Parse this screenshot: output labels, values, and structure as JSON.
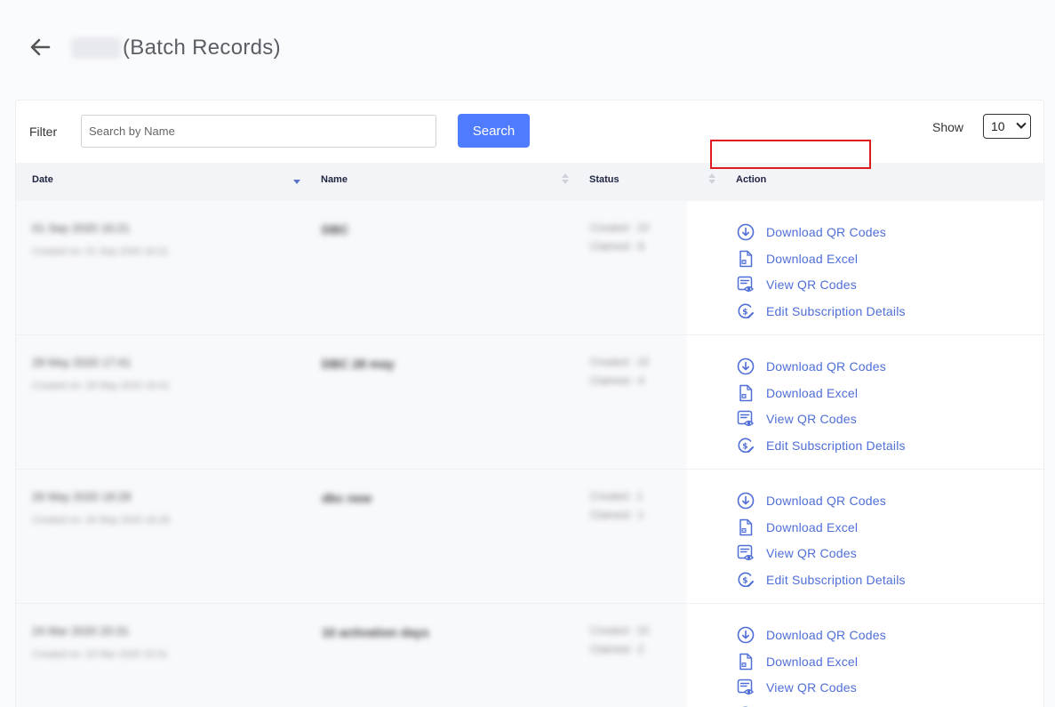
{
  "header": {
    "back_icon": "arrow-left-icon",
    "title_prefix_blurred": "DBC",
    "title_suffix": "(Batch Records)"
  },
  "filter": {
    "label": "Filter",
    "search_placeholder": "Search by Name",
    "search_value": "",
    "search_button": "Search",
    "show_label": "Show",
    "show_value": "10"
  },
  "table": {
    "columns": [
      {
        "label": "Date",
        "sort": "desc"
      },
      {
        "label": "Name",
        "sort": "none"
      },
      {
        "label": "Status",
        "sort": "none"
      },
      {
        "label": "Action",
        "sort": null
      }
    ],
    "rows": [
      {
        "date": "01 Sep 2020 16:21",
        "created": "Created on: 01 Sep 2020 16:21",
        "name": "DBC",
        "status_created": "Created : 10",
        "status_claimed": "Claimed : 8"
      },
      {
        "date": "28 May 2020 17:41",
        "created": "Created on: 28 May 2020 16:41",
        "name": "DBC 28 may",
        "status_created": "Created : 10",
        "status_claimed": "Claimed : 4"
      },
      {
        "date": "26 May 2020 18:28",
        "created": "Created on: 26 May 2020 16:28",
        "name": "dbc new",
        "status_created": "Created : 1",
        "status_claimed": "Claimed : 1"
      },
      {
        "date": "24 Mar 2020 20:31",
        "created": "Created on: 24 Mar 2020 15:31",
        "name": "10 activation days",
        "status_created": "Created : 10",
        "status_claimed": "Claimed : 2"
      }
    ],
    "actions": [
      {
        "label": "Download QR Codes",
        "icon": "download-circle-icon"
      },
      {
        "label": "Download Excel",
        "icon": "excel-file-icon"
      },
      {
        "label": "View QR Codes",
        "icon": "view-document-icon"
      },
      {
        "label": "Edit Subscription Details",
        "icon": "subscription-edit-icon"
      }
    ]
  },
  "colors": {
    "primary": "#4f7cff",
    "link": "#4f6ed8",
    "highlight": "#e0191f"
  }
}
